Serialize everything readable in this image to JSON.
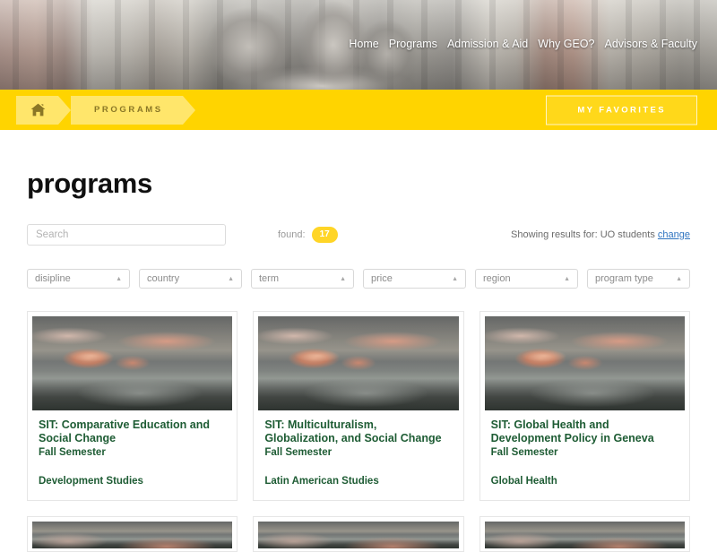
{
  "hero": {
    "image_alt": "trevi-fountain-rome-facade",
    "nav": [
      {
        "label": "Home",
        "name": "nav-home"
      },
      {
        "label": "Programs",
        "name": "nav-programs"
      },
      {
        "label": "Admission & Aid",
        "name": "nav-admission-aid"
      },
      {
        "label": "Why GEO?",
        "name": "nav-why-geo"
      },
      {
        "label": "Advisors & Faculty",
        "name": "nav-advisors-faculty"
      }
    ]
  },
  "breadcrumb": {
    "home_icon": "home-icon",
    "current": "PROGRAMS",
    "favorites_label": "MY FAVORITES"
  },
  "page": {
    "title": "programs"
  },
  "toolbar": {
    "search_placeholder": "Search",
    "search_value": "",
    "found_label": "found:",
    "found_count": "17",
    "showing_prefix": "Showing results for: UO students",
    "change_link": "change"
  },
  "filters": [
    {
      "label": "disipline",
      "name": "filter-discipline"
    },
    {
      "label": "country",
      "name": "filter-country"
    },
    {
      "label": "term",
      "name": "filter-term"
    },
    {
      "label": "price",
      "name": "filter-price"
    },
    {
      "label": "region",
      "name": "filter-region"
    },
    {
      "label": "program type",
      "name": "filter-program-type"
    }
  ],
  "caret": "▲",
  "cards": [
    {
      "title": "SIT: Comparative Education and Social Change",
      "term": "Fall Semester",
      "discipline": "Development Studies",
      "image_alt": "mountain-sunset-photo"
    },
    {
      "title": "SIT: Multiculturalism, Globalization, and Social Change",
      "term": "Fall Semester",
      "discipline": "Latin American Studies",
      "image_alt": "mountain-sunset-photo"
    },
    {
      "title": "SIT: Global Health and Development Policy in Geneva",
      "term": "Fall Semester",
      "discipline": "Global Health",
      "image_alt": "mountain-sunset-photo"
    }
  ],
  "colors": {
    "brand_yellow": "#FFD400",
    "crumb_yellow": "#FFE66B",
    "badge_yellow": "#FFD527",
    "card_green": "#1E5C34",
    "link_blue": "#2F74C0"
  }
}
